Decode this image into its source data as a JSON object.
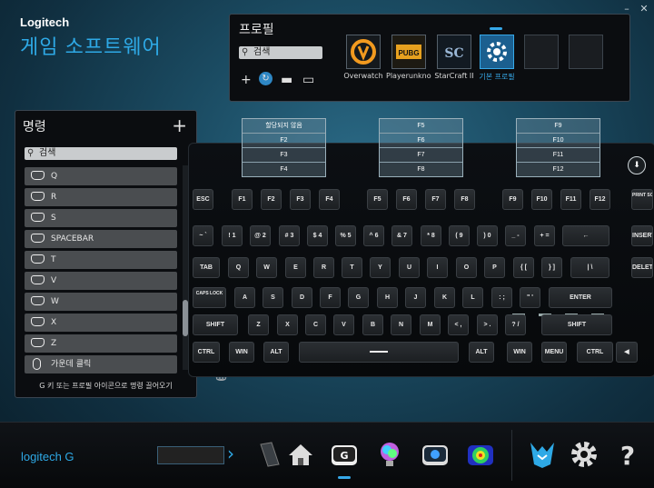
{
  "app": {
    "company": "Logitech",
    "product": "게임 소프트웨어"
  },
  "window_controls": [
    "minimize-icon",
    "close-icon"
  ],
  "profile_panel": {
    "title": "프로필",
    "search_placeholder": "검색",
    "profiles": [
      {
        "label": "Overwatch",
        "icon": "overwatch-icon",
        "active": false
      },
      {
        "label": "Playerunknown",
        "icon": "pubg-icon",
        "active": false
      },
      {
        "label": "StarCraft II",
        "icon": "starcraft-icon",
        "active": false
      },
      {
        "label": "기본 프로필",
        "icon": "gear-profile-icon",
        "active": true
      },
      {
        "label": "",
        "icon": "empty-slot",
        "active": false
      },
      {
        "label": "",
        "icon": "empty-slot",
        "active": false
      }
    ]
  },
  "commands_panel": {
    "title": "명령",
    "search_placeholder": "검색",
    "items": [
      {
        "label": "Q"
      },
      {
        "label": "R"
      },
      {
        "label": "S"
      },
      {
        "label": "SPACEBAR"
      },
      {
        "label": "T"
      },
      {
        "label": "V"
      },
      {
        "label": "W"
      },
      {
        "label": "X"
      },
      {
        "label": "Z"
      },
      {
        "label": "가운데 클릭"
      }
    ],
    "hint": "G 키 또는 프로필 아이콘으로 명령 끌어오기"
  },
  "assignments": {
    "col1": [
      "할당되지 않음",
      "F2",
      "F3",
      "F4"
    ],
    "col2": [
      "F5",
      "F6",
      "F7",
      "F8"
    ],
    "col3": [
      "F9",
      "F10",
      "F11",
      "F12"
    ]
  },
  "keyboard": {
    "rows": [
      [
        "ESC",
        "F1",
        "F2",
        "F3",
        "F4",
        "F5",
        "F6",
        "F7",
        "F8",
        "F9",
        "F10",
        "F11",
        "F12",
        "PRINT SCREEN SYSRQ"
      ],
      [
        "~ `",
        "! 1",
        "@ 2",
        "# 3",
        "$ 4",
        "% 5",
        "^ 6",
        "& 7",
        "* 8",
        "( 9",
        ") 0",
        "_ -",
        "+ =",
        "←",
        "INSERT"
      ],
      [
        "TAB",
        "Q",
        "W",
        "E",
        "R",
        "T",
        "Y",
        "U",
        "I",
        "O",
        "P",
        "{ [",
        "} ]",
        "| \\",
        "DELETE"
      ],
      [
        "CAPS LOCK",
        "A",
        "S",
        "D",
        "F",
        "G",
        "H",
        "J",
        "K",
        "L",
        ": ;",
        "\" '",
        "ENTER"
      ],
      [
        "SHIFT",
        "Z",
        "X",
        "C",
        "V",
        "B",
        "N",
        "M",
        "< ,",
        "> .",
        "? /",
        "SHIFT"
      ],
      [
        "CTRL",
        "WIN",
        "ALT",
        "",
        "ALT",
        "WIN",
        "MENU",
        "CTRL",
        "◀"
      ]
    ]
  },
  "bottom_bar": {
    "logo": "logitech G",
    "icons": [
      "home-icon",
      "g-key-icon",
      "lighting-icon",
      "performance-icon",
      "heatmap-icon",
      "arx-icon",
      "settings-icon",
      "help-icon"
    ],
    "selected": "g-key-icon"
  },
  "colors": {
    "accent": "#2ea9e6",
    "panel": "#0b0d10",
    "item": "#4a4d50"
  }
}
